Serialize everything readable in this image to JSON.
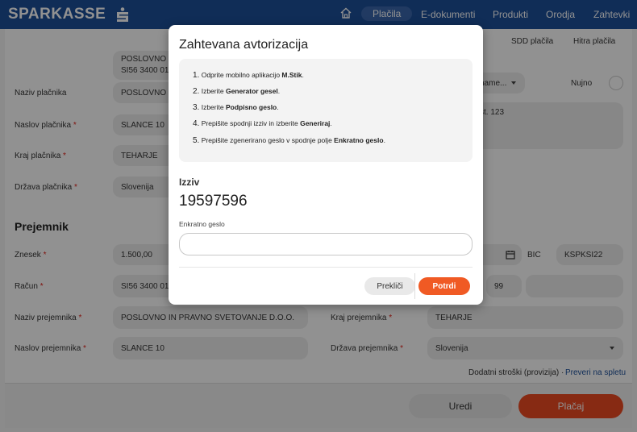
{
  "brand": {
    "name": "SPARKASSE",
    "accent": "#1d4f9a",
    "action": "#ee4b23"
  },
  "nav": {
    "icon": "home-icon",
    "items": [
      "Plačila",
      "E-dokumenti",
      "Produkti",
      "Orodja",
      "Zahtevki"
    ]
  },
  "subtabs": [
    "SDD plačila",
    "Hitra plačila"
  ],
  "form": {
    "top_value_line1": "POSLOVNO IN PRAVNO SVETOVANJE D.O.O.",
    "top_value_line2": "SI56 3400 0100 0000 000",
    "payer_name_label": "Naziv plačnika",
    "payer_name_value": "POSLOVNO IN PRAVNO SVETOVANJE D.O.O.",
    "payer_address_label": "Naslov plačnika",
    "payer_address_value": "SLANCE 10",
    "payer_city_label": "Kraj plačnika",
    "payer_city_value": "TEHARJE",
    "payer_country_label": "Država plačnika",
    "payer_country_value": "Slovenija",
    "name_select": "name...",
    "urgent_label": "Nujno",
    "purpose_value": "št. 123",
    "recipient_heading": "Prejemnik",
    "amount_label": "Znesek",
    "amount_value": "1.500,00",
    "bic_label": "BIC",
    "bic_value": "KSPKSI22",
    "account_label": "Račun",
    "account_value": "SI56 3400 0100 0000 000",
    "reference_value": "99",
    "recipient_name_label": "Naziv prejemnika",
    "recipient_name_value": "POSLOVNO IN PRAVNO SVETOVANJE D.O.O.",
    "recipient_city_label": "Kraj prejemnika",
    "recipient_city_value": "TEHARJE",
    "recipient_address_label": "Naslov prejemnika",
    "recipient_address_value": "SLANCE 10",
    "recipient_country_label": "Država prejemnika",
    "recipient_country_value": "Slovenija",
    "fee_text": "Dodatni stroški (provizija) ·",
    "fee_link": "Preveri na spletu"
  },
  "footer": {
    "edit": "Uredi",
    "pay": "Plačaj"
  },
  "modal": {
    "title": "Zahtevana avtorizacija",
    "steps": [
      {
        "num": "1.",
        "pre": "Odprite mobilno aplikacijo ",
        "bold": "M.Stik",
        "post": "."
      },
      {
        "num": "2.",
        "pre": "Izberite ",
        "bold": "Generator gesel",
        "post": "."
      },
      {
        "num": "3.",
        "pre": "Izberite ",
        "bold": "Podpisno geslo",
        "post": "."
      },
      {
        "num": "4.",
        "pre": "Prepišite spodnji izziv in izberite ",
        "bold": "Generiraj",
        "post": "."
      },
      {
        "num": "5.",
        "pre": "Prepišite zgenerirano geslo v spodnje polje ",
        "bold": "Enkratno geslo",
        "post": "."
      }
    ],
    "challenge_label": "Izziv",
    "challenge_value": "19597596",
    "otp_label": "Enkratno geslo",
    "otp_value": "",
    "cancel": "Prekliči",
    "confirm": "Potrdi"
  }
}
